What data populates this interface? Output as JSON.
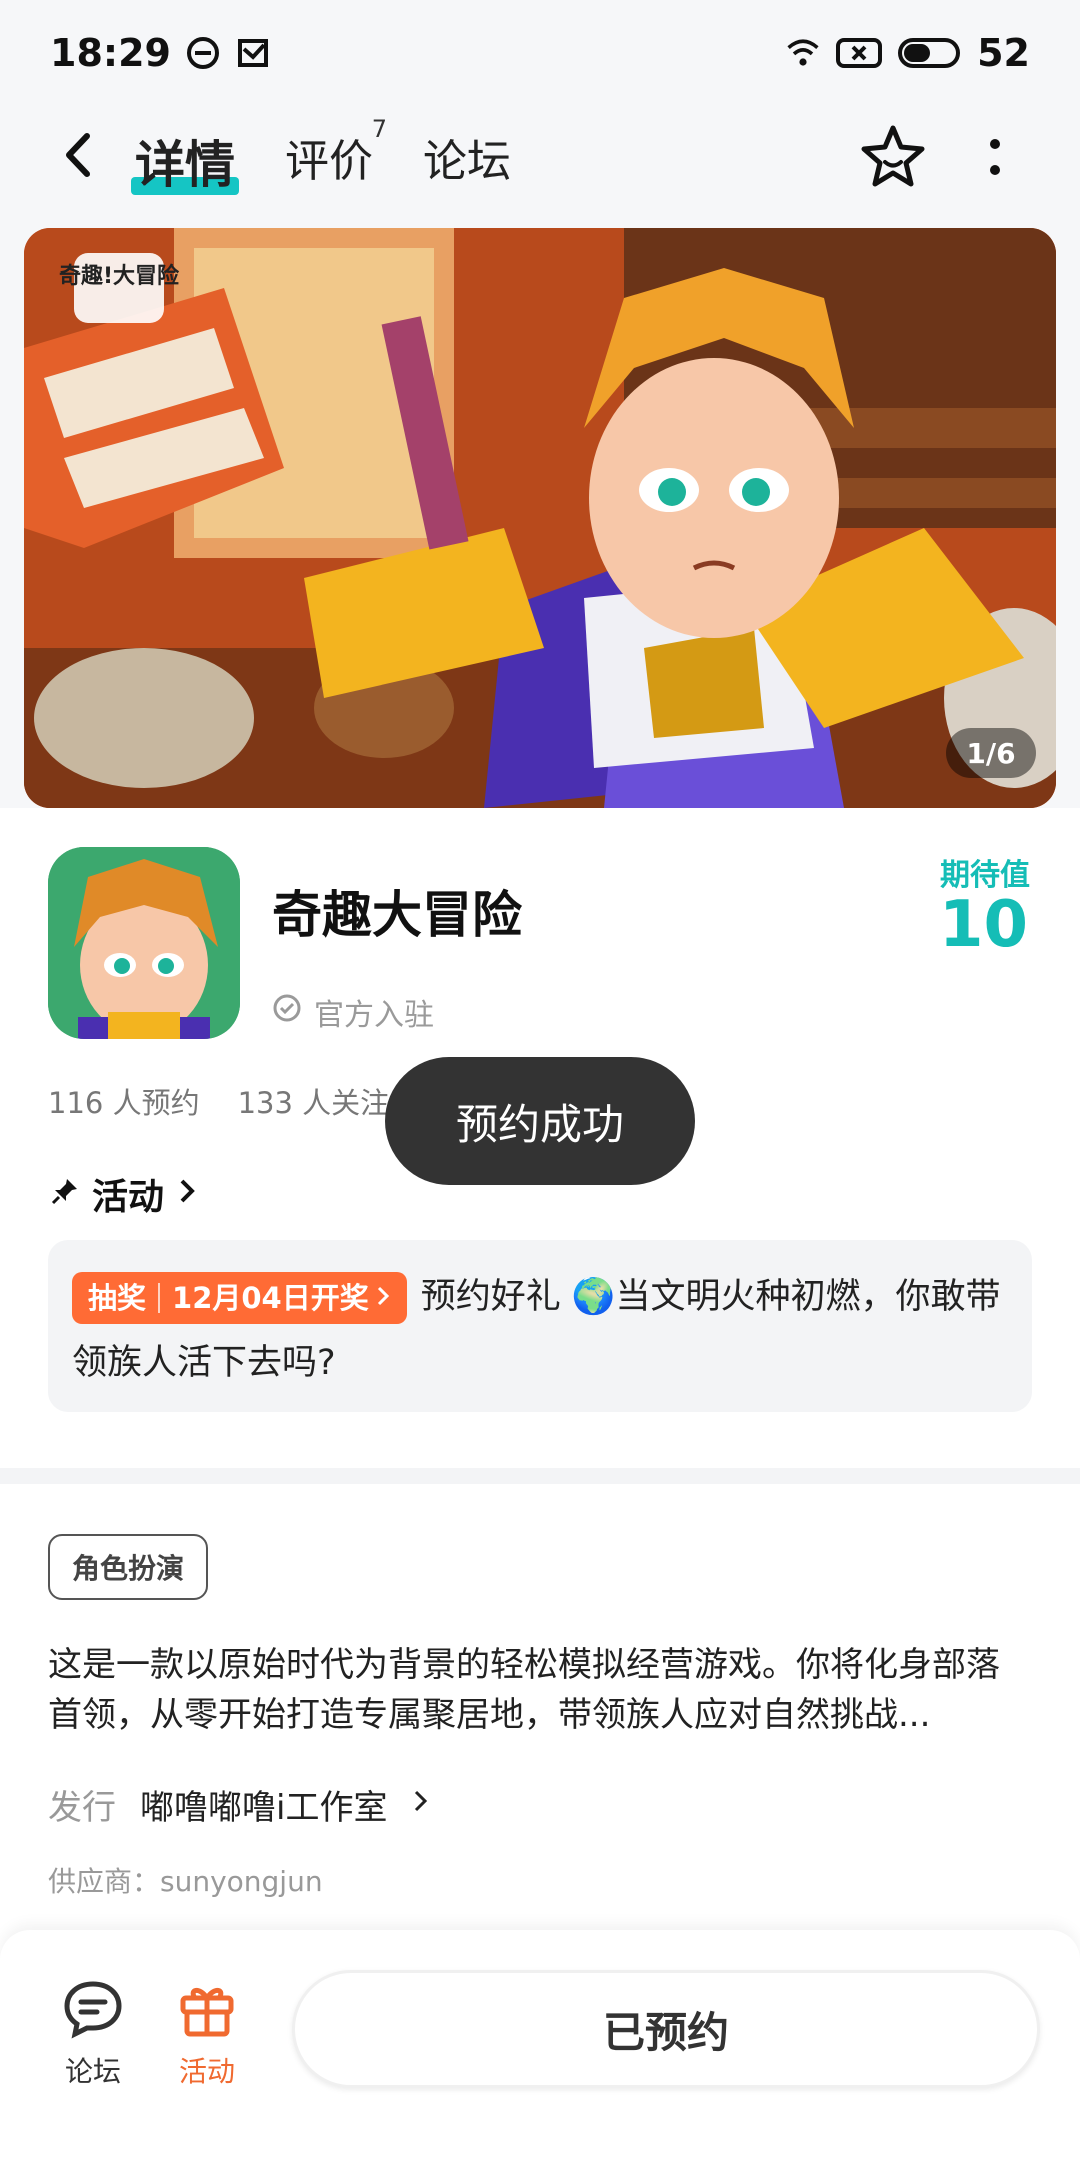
{
  "status_bar": {
    "time": "18:29",
    "battery": "52",
    "icons": [
      "dnd-icon",
      "mail-icon",
      "wifi-icon",
      "sim-x-icon",
      "battery-icon"
    ]
  },
  "nav": {
    "tabs": [
      {
        "label": "详情",
        "active": true
      },
      {
        "label": "评价",
        "badge": "7"
      },
      {
        "label": "论坛"
      }
    ],
    "icons": [
      "back-icon",
      "star-face-icon",
      "more-icon"
    ]
  },
  "banner": {
    "logo_text": "奇趣!大冒险",
    "counter": "1/6"
  },
  "app": {
    "title": "奇趣大冒险",
    "official_label": "官方入驻",
    "expect_label": "期待值",
    "expect_value": "10",
    "reservations": "116 人预约",
    "followers": "133 人关注"
  },
  "toast": "预约成功",
  "activity": {
    "heading": "活动",
    "badge_left": "抽奖",
    "badge_right": "12月04日开奖",
    "text": "预约好礼 🌍当文明火种初燃，你敢带领族人活下去吗?"
  },
  "details": {
    "genre": "角色扮演",
    "description": "这是一款以原始时代为背景的轻松模拟经营游戏。你将化身部落首领，从零开始打造专属聚居地，带领族人应对自然挑战...",
    "publisher_label": "发行",
    "publisher_value": "嘟噜嘟噜i工作室",
    "supplier": "供应商：sunyongjun"
  },
  "bottom_bar": {
    "forum_label": "论坛",
    "activity_label": "活动",
    "reserved_label": "已预约"
  },
  "colors": {
    "accent_teal": "#15bdb6",
    "accent_orange": "#ff6b35",
    "toast_bg": "#333333"
  }
}
